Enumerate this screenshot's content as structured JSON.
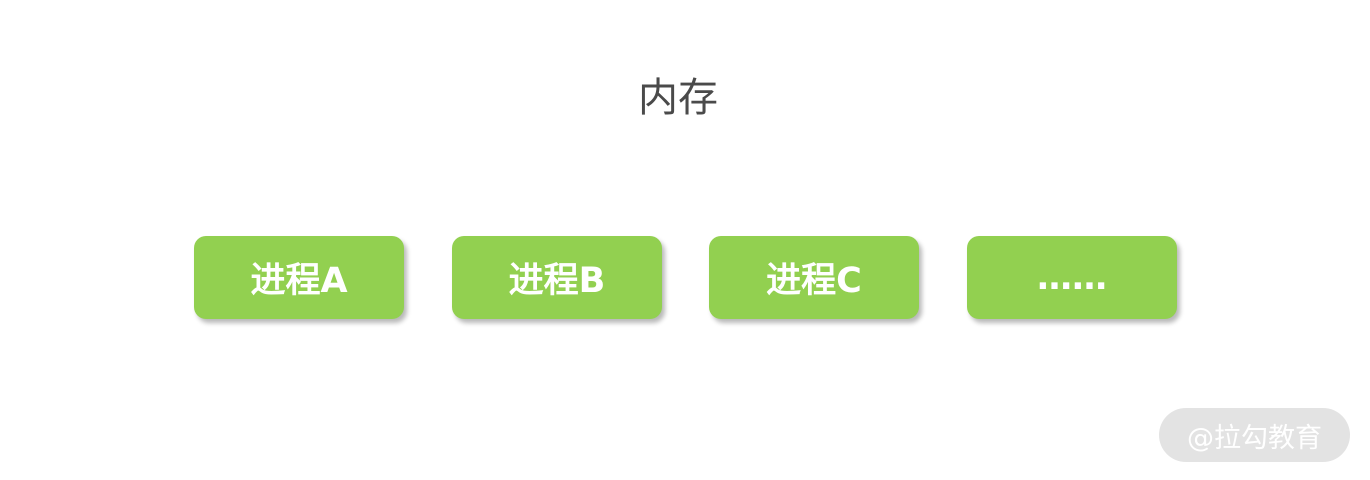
{
  "diagram": {
    "title": "内存",
    "processes": [
      {
        "label": "进程A"
      },
      {
        "label": "进程B"
      },
      {
        "label": "进程C"
      },
      {
        "label": "……"
      }
    ],
    "colors": {
      "process_fill": "#92d050",
      "process_text": "#ffffff",
      "title_text": "#4a4a4a"
    }
  },
  "watermark": {
    "text": "@拉勾教育"
  }
}
